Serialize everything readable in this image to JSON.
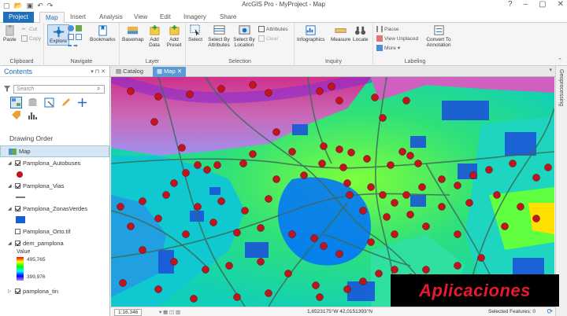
{
  "app": {
    "title": "ArcGIS Pro - MyProject - Map"
  },
  "tabs": [
    "Project",
    "Map",
    "Insert",
    "Analysis",
    "View",
    "Edit",
    "Imagery",
    "Share"
  ],
  "ribbon": {
    "clipboard": {
      "label": "Clipboard",
      "paste": "Paste",
      "cut": "Cut",
      "copy": "Copy"
    },
    "navigate": {
      "label": "Navigate",
      "explore": "Explore",
      "bookmarks": "Bookmarks"
    },
    "layer": {
      "label": "Layer",
      "basemap": "Basemap",
      "add_data": "Add Data",
      "add_preset": "Add Preset"
    },
    "selection": {
      "label": "Selection",
      "select": "Select",
      "select_by_attributes": "Select By Attributes",
      "select_by_location": "Select By Location",
      "attributes": "Attributes",
      "clear": "Clear"
    },
    "inquiry": {
      "label": "Inquiry",
      "infographics": "Infographics",
      "measure": "Measure",
      "locate": "Locate"
    },
    "labeling": {
      "label": "Labeling",
      "pause": "Pause",
      "view_unplaced": "View Unplaced",
      "more": "More",
      "convert": "Convert To Annotation"
    }
  },
  "contents": {
    "title": "Contents",
    "search_placeholder": "Search",
    "drawing_order": "Drawing Order",
    "layers": [
      {
        "name": "Map"
      },
      {
        "name": "Pamplona_Autobuses"
      },
      {
        "name": "Pamplona_Vias"
      },
      {
        "name": "Pamplona_ZonasVerdes"
      },
      {
        "name": "Pamplona_Orto.tif"
      },
      {
        "name": "dem_pamplona"
      },
      {
        "name": "pamplona_tin"
      }
    ],
    "legend": {
      "value_label": "Value",
      "high": "495,765",
      "low": "399,976"
    }
  },
  "view_tabs": {
    "catalog": "Catalog",
    "map": "Map"
  },
  "statusbar": {
    "scale": "1:16,346",
    "coords": "1,6523175°W 42,0151393°N",
    "selected": "Selected Features: 0"
  },
  "geoprocessing": "Geoprocessing",
  "banner": "Aplicaciones",
  "colors": {
    "accent": "#1f6fbf",
    "bus_stop": "#c0141e",
    "banner_text": "#e8192c"
  }
}
